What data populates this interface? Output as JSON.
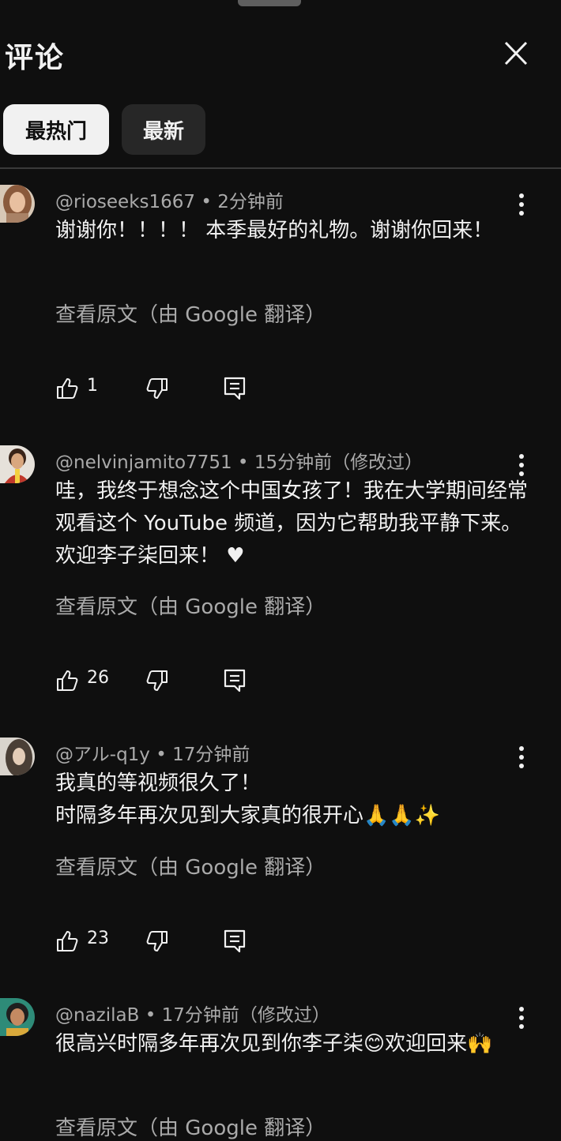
{
  "header": {
    "title": "评论"
  },
  "tabs": [
    {
      "label": "最热门",
      "selected": true
    },
    {
      "label": "最新",
      "selected": false
    }
  ],
  "comments": [
    {
      "author": "@rioseeks1667",
      "meta": "2分钟前",
      "text": "谢谢你！！！！ 本季最好的礼物。谢谢你回来！",
      "translate": "查看原文（由 Google 翻译）",
      "likes": "1",
      "avatar_color": "#a98266"
    },
    {
      "author": "@nelvinjamito7751",
      "meta": "15分钟前（修改过）",
      "text": "哇，我终于想念这个中国女孩了！我在大学期间经常观看这个 YouTube 频道，因为它帮助我平静下来。欢迎李子柒回来！ ♥",
      "translate": "查看原文（由 Google 翻译）",
      "likes": "26",
      "avatar_color": "#c0392b"
    },
    {
      "author": "@アル-q1y",
      "meta": "17分钟前",
      "text_lines": [
        "我真的等视频很久了！",
        "时隔多年再次见到大家真的很开心🙏🙏✨"
      ],
      "translate": "查看原文（由 Google 翻译）",
      "likes": "23",
      "avatar_color": "#6b6157"
    },
    {
      "author": "@nazilaB",
      "meta": "17分钟前（修改过）",
      "text": "很高兴时隔多年再次见到你李子柒😊欢迎回来🙌",
      "translate": "查看原文（由 Google 翻译）",
      "avatar_color": "#2e8b78"
    }
  ]
}
